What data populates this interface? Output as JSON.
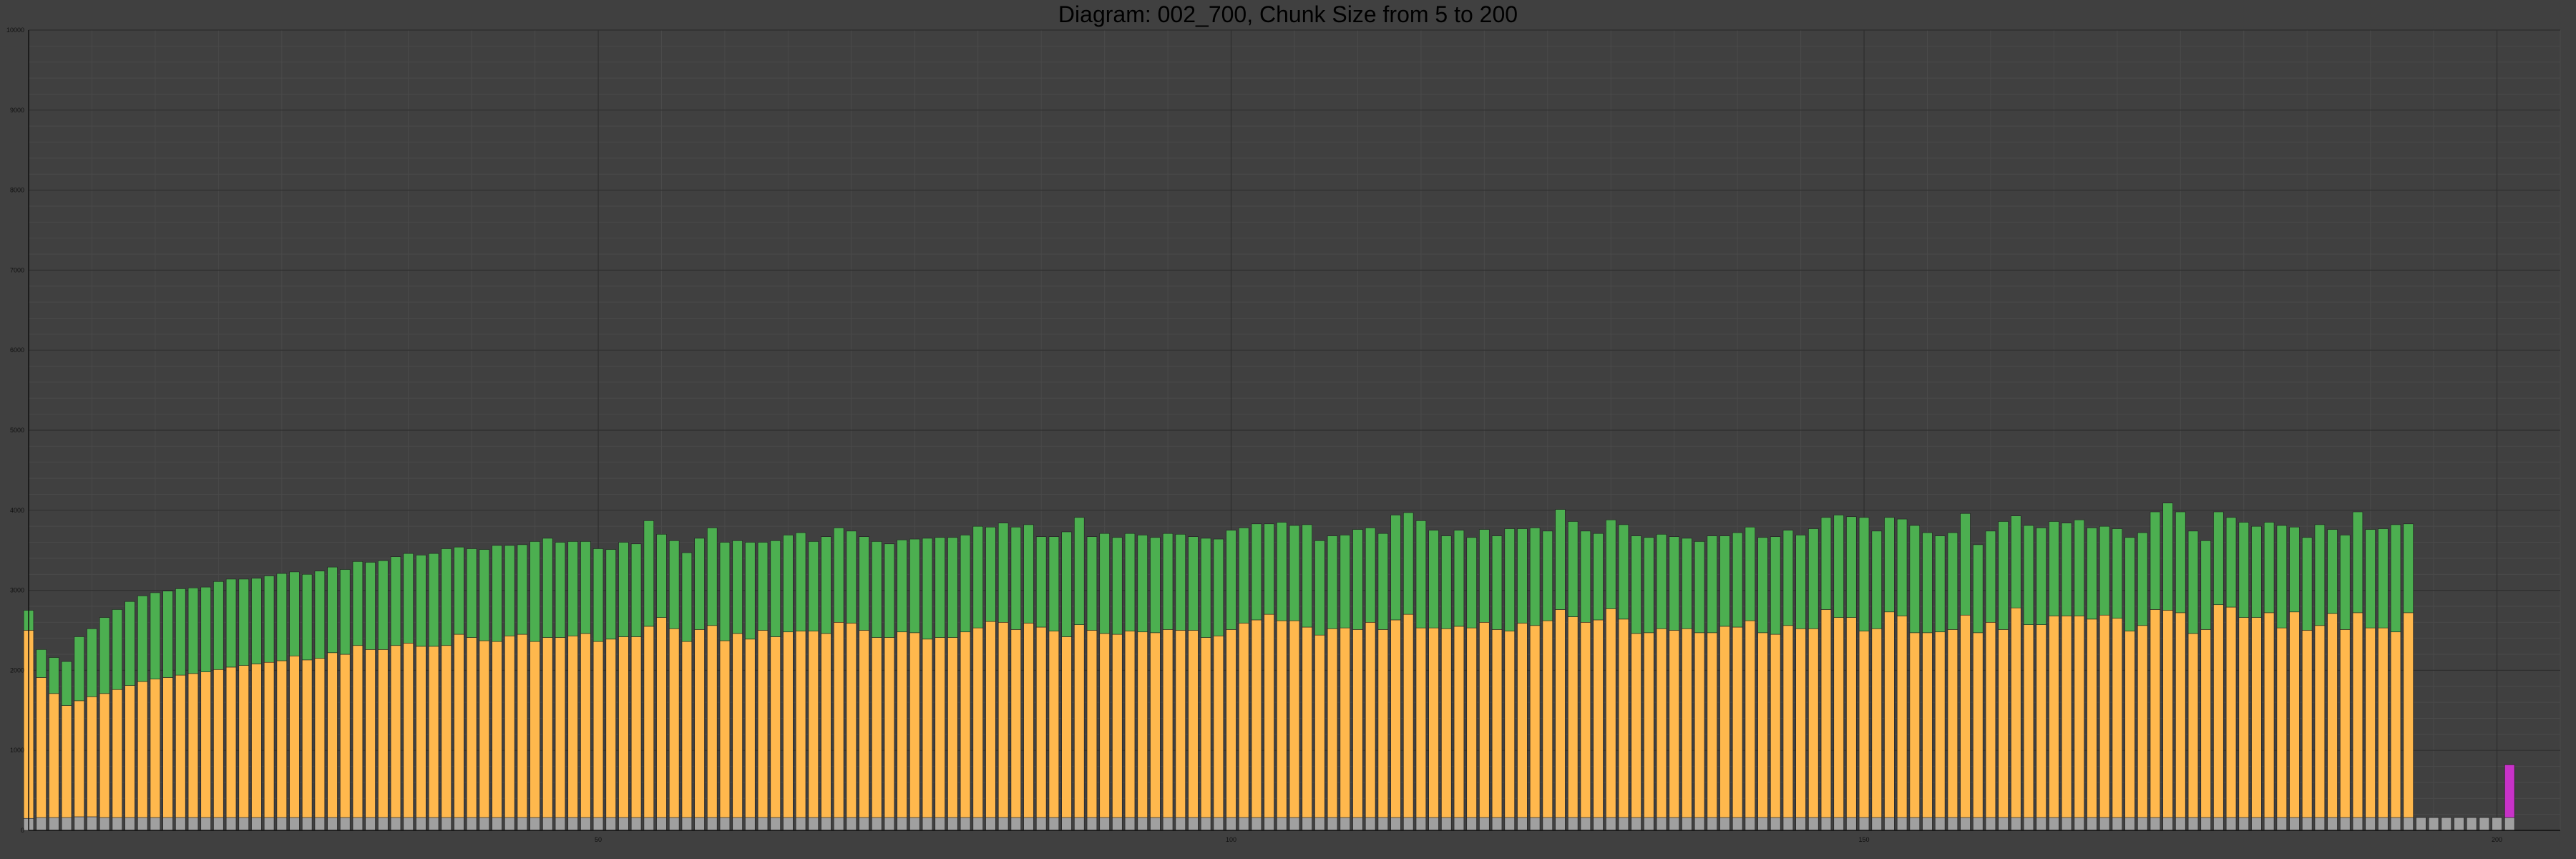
{
  "chart_data": {
    "type": "bar",
    "stacked": true,
    "title": "Diagram: 002_700, Chunk Size from 5 to 200",
    "xlabel": "",
    "ylabel": "",
    "xlim": [
      5,
      205
    ],
    "ylim": [
      0,
      10000
    ],
    "x_ticks": [
      50,
      100,
      150,
      200
    ],
    "y_ticks": [
      0,
      1000,
      2000,
      3000,
      4000,
      5000,
      6000,
      7000,
      8000,
      9000,
      10000
    ],
    "grid": true,
    "x_start": 5,
    "x_step": 1,
    "series": [
      {
        "color": "#a0a0a0",
        "values": [
          150,
          160,
          160,
          160,
          170,
          170,
          160,
          160,
          160,
          160,
          160,
          160,
          160,
          160,
          160,
          160,
          160,
          160,
          160,
          160,
          160,
          160,
          160,
          160,
          160,
          160,
          160,
          160,
          160,
          160,
          160,
          160,
          160,
          160,
          160,
          160,
          160,
          160,
          160,
          160,
          160,
          160,
          160,
          160,
          160,
          160,
          160,
          160,
          160,
          160,
          160,
          160,
          160,
          160,
          160,
          160,
          160,
          160,
          160,
          160,
          160,
          160,
          160,
          160,
          160,
          160,
          160,
          160,
          160,
          160,
          160,
          160,
          160,
          160,
          160,
          160,
          160,
          160,
          160,
          160,
          160,
          160,
          160,
          160,
          160,
          160,
          160,
          160,
          160,
          160,
          160,
          160,
          160,
          160,
          160,
          160,
          160,
          160,
          160,
          160,
          160,
          160,
          160,
          160,
          160,
          160,
          160,
          160,
          160,
          160,
          160,
          160,
          160,
          160,
          160,
          160,
          160,
          160,
          160,
          160,
          160,
          160,
          160,
          160,
          160,
          160,
          160,
          160,
          160,
          160,
          160,
          160,
          160,
          160,
          160,
          160,
          160,
          160,
          160,
          160,
          160,
          160,
          160,
          160,
          160,
          160,
          160,
          160,
          160,
          160,
          160,
          160,
          160,
          160,
          160,
          160,
          160,
          160,
          160,
          160,
          160,
          160,
          160,
          160,
          160,
          160,
          160,
          160,
          160,
          160,
          160,
          160,
          160,
          160,
          160,
          160,
          160,
          160,
          160,
          160,
          160,
          160,
          160,
          160,
          160,
          160,
          160,
          160,
          160,
          160,
          160,
          160,
          160,
          160,
          160,
          160,
          160
        ]
      },
      {
        "color": "#ffb84d",
        "values": [
          2350,
          1750,
          1550,
          1400,
          1450,
          1500,
          1550,
          1600,
          1650,
          1700,
          1730,
          1750,
          1780,
          1800,
          1820,
          1850,
          1880,
          1900,
          1920,
          1940,
          1960,
          2020,
          1970,
          1990,
          2060,
          2040,
          2150,
          2100,
          2100,
          2150,
          2180,
          2140,
          2140,
          2150,
          2290,
          2250,
          2210,
          2200,
          2270,
          2290,
          2200,
          2250,
          2250,
          2270,
          2300,
          2200,
          2230,
          2260,
          2260,
          2390,
          2500,
          2360,
          2200,
          2350,
          2400,
          2210,
          2300,
          2230,
          2340,
          2260,
          2320,
          2330,
          2330,
          2300,
          2440,
          2430,
          2340,
          2250,
          2250,
          2320,
          2310,
          2230,
          2250,
          2250,
          2320,
          2370,
          2450,
          2440,
          2350,
          2430,
          2380,
          2330,
          2260,
          2410,
          2340,
          2300,
          2290,
          2330,
          2320,
          2310,
          2350,
          2340,
          2340,
          2250,
          2270,
          2350,
          2430,
          2470,
          2540,
          2460,
          2460,
          2380,
          2280,
          2360,
          2370,
          2350,
          2440,
          2350,
          2470,
          2540,
          2370,
          2370,
          2360,
          2390,
          2370,
          2440,
          2350,
          2330,
          2430,
          2400,
          2460,
          2600,
          2510,
          2440,
          2470,
          2610,
          2480,
          2300,
          2310,
          2360,
          2340,
          2360,
          2310,
          2310,
          2390,
          2380,
          2460,
          2310,
          2290,
          2400,
          2360,
          2360,
          2600,
          2500,
          2500,
          2330,
          2360,
          2570,
          2520,
          2310,
          2310,
          2320,
          2350,
          2530,
          2310,
          2440,
          2350,
          2620,
          2410,
          2410,
          2520,
          2520,
          2520,
          2480,
          2530,
          2490,
          2330,
          2400,
          2600,
          2590,
          2560,
          2300,
          2350,
          2660,
          2630,
          2500,
          2500,
          2560,
          2370,
          2570,
          2340,
          2400,
          2550,
          2350,
          2560,
          2370,
          2370,
          2320,
          2560
        ]
      },
      {
        "color": "#4caf50",
        "values": [
          250,
          350,
          450,
          550,
          800,
          850,
          950,
          1000,
          1050,
          1070,
          1080,
          1080,
          1080,
          1070,
          1060,
          1100,
          1100,
          1080,
          1070,
          1080,
          1090,
          1050,
          1070,
          1090,
          1070,
          1060,
          1050,
          1090,
          1110,
          1110,
          1120,
          1140,
          1160,
          1210,
          1090,
          1110,
          1140,
          1200,
          1130,
          1120,
          1250,
          1240,
          1190,
          1180,
          1150,
          1160,
          1120,
          1180,
          1160,
          1320,
          1040,
          1100,
          1110,
          1140,
          1220,
          1230,
          1160,
          1210,
          1100,
          1200,
          1210,
          1230,
          1120,
          1210,
          1180,
          1150,
          1170,
          1200,
          1170,
          1150,
          1170,
          1260,
          1250,
          1250,
          1210,
          1270,
          1180,
          1240,
          1280,
          1230,
          1130,
          1180,
          1310,
          1340,
          1170,
          1250,
          1210,
          1220,
          1210,
          1190,
          1200,
          1200,
          1170,
          1240,
          1210,
          1240,
          1190,
          1200,
          1130,
          1230,
          1190,
          1280,
          1180,
          1160,
          1160,
          1250,
          1180,
          1200,
          1310,
          1270,
          1340,
          1220,
          1160,
          1200,
          1130,
          1160,
          1170,
          1280,
          1180,
          1220,
          1120,
          1250,
          1190,
          1140,
          1080,
          1110,
          1180,
          1220,
          1190,
          1180,
          1170,
          1130,
          1140,
          1210,
          1130,
          1180,
          1170,
          1190,
          1220,
          1190,
          1170,
          1250,
          1150,
          1280,
          1260,
          1420,
          1220,
          1180,
          1210,
          1340,
          1250,
          1200,
          1210,
          1270,
          1100,
          1140,
          1350,
          1150,
          1240,
          1210,
          1180,
          1160,
          1200,
          1140,
          1110,
          1120,
          1170,
          1160,
          1220,
          1340,
          1260,
          1280,
          1110,
          1160,
          1120,
          1190,
          1140,
          1130,
          1280,
          1060,
          1160,
          1260,
          1050,
          1180,
          1260,
          1230,
          1240,
          1340,
          1110
        ]
      },
      {
        "color": "#c832c8",
        "values": [
          0,
          0,
          0,
          0,
          0,
          0,
          0,
          0,
          0,
          0,
          0,
          0,
          0,
          0,
          0,
          0,
          0,
          0,
          0,
          0,
          0,
          0,
          0,
          0,
          0,
          0,
          0,
          0,
          0,
          0,
          0,
          0,
          0,
          0,
          0,
          0,
          0,
          0,
          0,
          0,
          0,
          0,
          0,
          0,
          0,
          0,
          0,
          0,
          0,
          0,
          0,
          0,
          0,
          0,
          0,
          0,
          0,
          0,
          0,
          0,
          0,
          0,
          0,
          0,
          0,
          0,
          0,
          0,
          0,
          0,
          0,
          0,
          0,
          0,
          0,
          0,
          0,
          0,
          0,
          0,
          0,
          0,
          0,
          0,
          0,
          0,
          0,
          0,
          0,
          0,
          0,
          0,
          0,
          0,
          0,
          0,
          0,
          0,
          0,
          0,
          0,
          0,
          0,
          0,
          0,
          0,
          0,
          0,
          0,
          0,
          0,
          0,
          0,
          0,
          0,
          0,
          0,
          0,
          0,
          0,
          0,
          0,
          0,
          0,
          0,
          0,
          0,
          0,
          0,
          0,
          0,
          0,
          0,
          0,
          0,
          0,
          0,
          0,
          0,
          0,
          0,
          0,
          0,
          0,
          0,
          0,
          0,
          0,
          0,
          0,
          0,
          0,
          0,
          0,
          0,
          0,
          0,
          0,
          0,
          0,
          0,
          0,
          0,
          0,
          0,
          0,
          0,
          0,
          0,
          0,
          0,
          0,
          0,
          0,
          0,
          0,
          0,
          0,
          0,
          0,
          0,
          0,
          0,
          0,
          0,
          0,
          0,
          0,
          0,
          0,
          0,
          0,
          0,
          0,
          0,
          0,
          660
        ]
      }
    ]
  }
}
